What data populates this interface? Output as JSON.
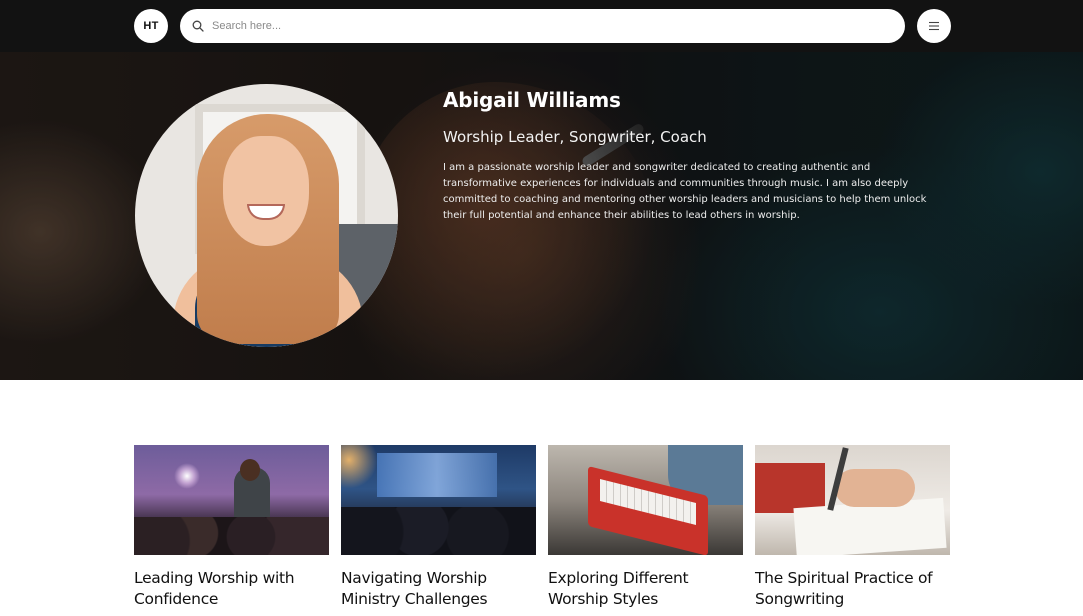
{
  "header": {
    "avatar_initials": "HT",
    "search": {
      "placeholder": "Search here..."
    }
  },
  "hero": {
    "name": "Abigail Williams",
    "role": "Worship Leader, Songwriter, Coach",
    "bio": "I am a passionate worship leader and songwriter dedicated to creating authentic and transformative experiences for individuals and communities through music. I am also deeply committed to coaching and mentoring other worship leaders and musicians to help them unlock their full potential and enhance their abilities to lead others in worship."
  },
  "cards": [
    {
      "title": "Leading Worship with Confidence"
    },
    {
      "title": "Navigating Worship Ministry Challenges"
    },
    {
      "title": "Exploring Different Worship Styles"
    },
    {
      "title": "The Spiritual Practice of Songwriting"
    }
  ],
  "icons": {
    "search": "search-icon",
    "menu": "hamburger-menu-icon"
  },
  "colors": {
    "topbar": "#121212",
    "hero_text": "#ffffff",
    "card_title": "#111111"
  }
}
